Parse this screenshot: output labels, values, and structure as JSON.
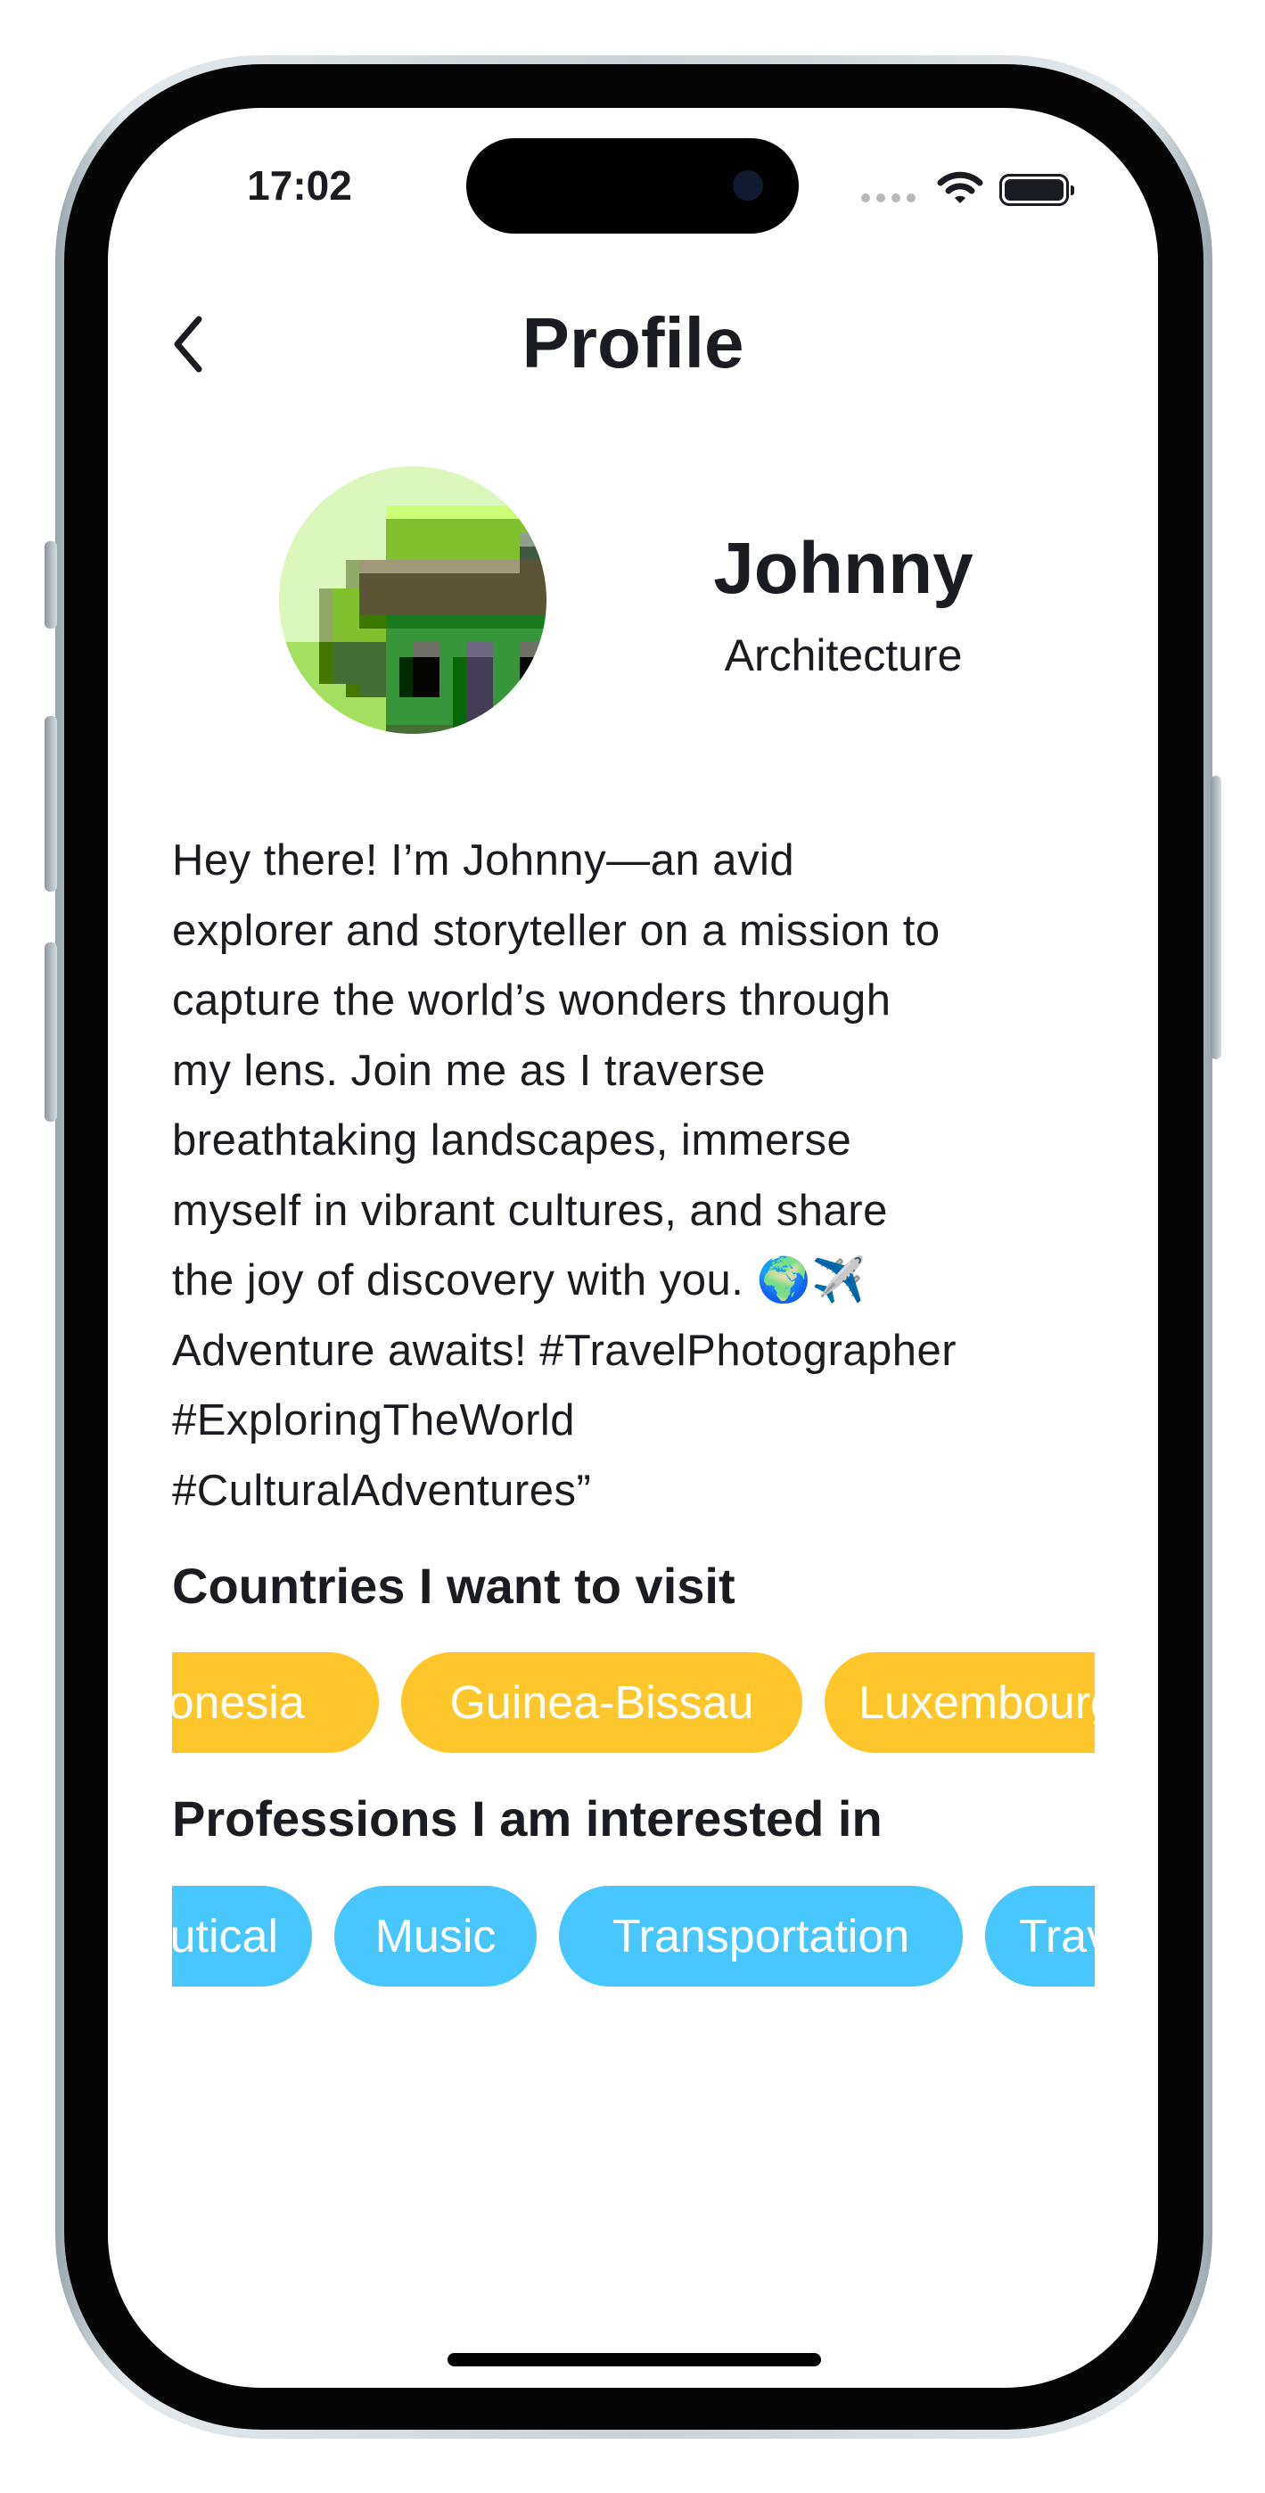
{
  "status_bar": {
    "time": "17:02"
  },
  "header": {
    "title": "Profile",
    "back_icon": "chevron-left-icon"
  },
  "profile": {
    "name": "Johnny",
    "profession": "Architecture"
  },
  "bio": {
    "lines": [
      "Hey there! I’m Johnny—an avid",
      "explorer and storyteller on a mission to",
      "capture the world’s wonders through",
      "my lens. Join me as I traverse",
      "breathtaking landscapes, immerse",
      "myself in vibrant cultures, and share",
      "the joy of discovery with you. 🌍✈️",
      "Adventure awaits! #TravelPhotographer",
      "#ExploringTheWorld",
      "#CulturalAdventures”"
    ]
  },
  "countries": {
    "heading": "Countries I want to visit",
    "items": [
      "Indonesia",
      "Guinea-Bissau",
      "Luxembourg"
    ],
    "color": "#fdc72c"
  },
  "professions": {
    "heading": "Professions I am interested in",
    "items": [
      "Nautical",
      "Music",
      "Transportation",
      "Travel"
    ],
    "color": "#48c7fe"
  }
}
